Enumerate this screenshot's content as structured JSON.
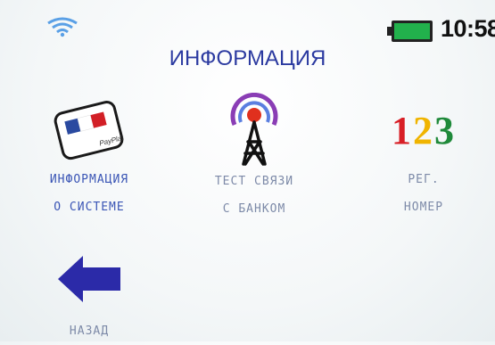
{
  "status": {
    "time": "10:58",
    "battery_color": "#22b14c",
    "wifi_icon": "wifi-icon"
  },
  "title": "ИНФОРМАЦИЯ",
  "tiles": [
    {
      "id": "system-info",
      "label": "ИНФОРМАЦИЯ\nО СИСТЕМЕ",
      "icon": "card-icon",
      "card_text": "PayPlat"
    },
    {
      "id": "bank-test",
      "label": "ТЕСТ СВЯЗИ\nС БАНКОМ",
      "icon": "antenna-icon"
    },
    {
      "id": "reg-number",
      "label": "РЕГ.\nНОМЕР",
      "icon": "numbers-icon",
      "digits": [
        "1",
        "2",
        "3"
      ]
    },
    {
      "id": "back",
      "label": "НАЗАД",
      "icon": "back-arrow-icon"
    }
  ],
  "colors": {
    "accent": "#2b3aa0",
    "digit_1": "#d81f26",
    "digit_2": "#f0b400",
    "digit_3": "#1f8a3a"
  }
}
